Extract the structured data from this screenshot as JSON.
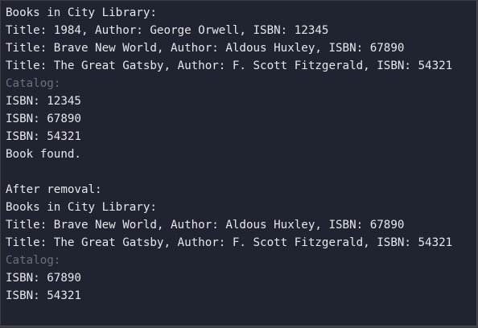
{
  "output": {
    "lines": [
      {
        "text": "Books in City Library:",
        "dim": false
      },
      {
        "text": "Title: 1984, Author: George Orwell, ISBN: 12345",
        "dim": false
      },
      {
        "text": "Title: Brave New World, Author: Aldous Huxley, ISBN: 67890",
        "dim": false
      },
      {
        "text": "Title: The Great Gatsby, Author: F. Scott Fitzgerald, ISBN: 54321",
        "dim": false
      },
      {
        "text": "Catalog:",
        "dim": true
      },
      {
        "text": "ISBN: 12345",
        "dim": false
      },
      {
        "text": "ISBN: 67890",
        "dim": false
      },
      {
        "text": "ISBN: 54321",
        "dim": false
      },
      {
        "text": "Book found.",
        "dim": false
      },
      {
        "text": "",
        "dim": false
      },
      {
        "text": "After removal:",
        "dim": false
      },
      {
        "text": "Books in City Library:",
        "dim": false
      },
      {
        "text": "Title: Brave New World, Author: Aldous Huxley, ISBN: 67890",
        "dim": false
      },
      {
        "text": "Title: The Great Gatsby, Author: F. Scott Fitzgerald, ISBN: 54321",
        "dim": false
      },
      {
        "text": "Catalog:",
        "dim": true
      },
      {
        "text": "ISBN: 67890",
        "dim": false
      },
      {
        "text": "ISBN: 54321",
        "dim": false
      }
    ]
  },
  "colors": {
    "background": "#1f2430",
    "text": "#e6e8ec",
    "dim_text": "#6b7079"
  }
}
